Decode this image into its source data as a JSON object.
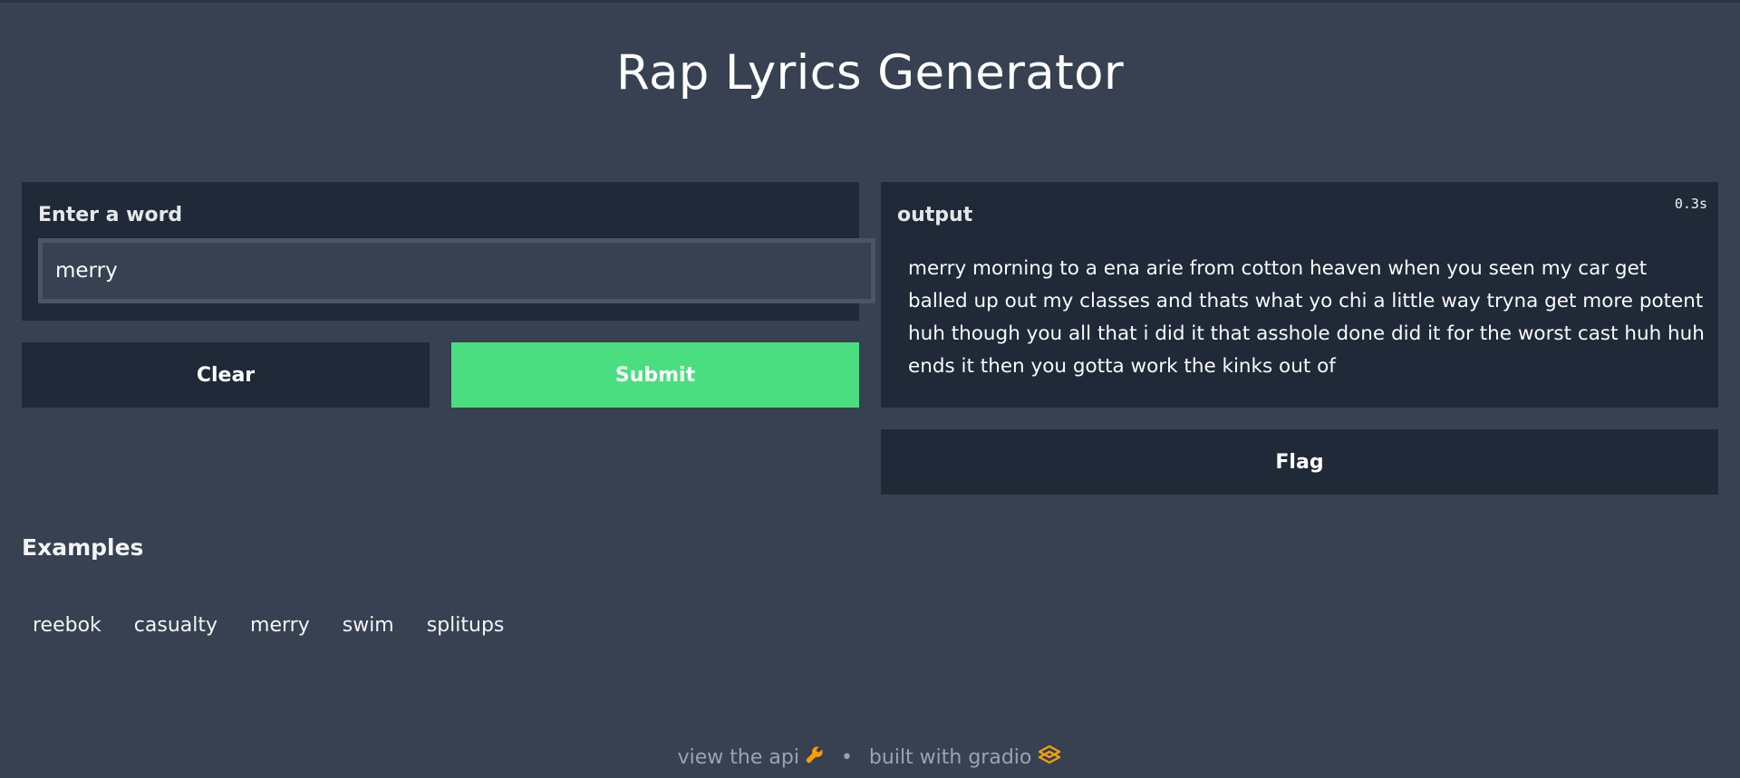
{
  "app": {
    "title": "Rap Lyrics Generator"
  },
  "input": {
    "label": "Enter a word",
    "value": "merry"
  },
  "buttons": {
    "clear": "Clear",
    "submit": "Submit",
    "flag": "Flag"
  },
  "output": {
    "label": "output",
    "timer": "0.3s",
    "text": "merry morning to a ena arie from cotton heaven when you seen my car get balled up out my classes and thats what yo chi a little way tryna get more potent huh though you all that i did it that asshole done did it for the worst cast huh huh ends it then you gotta work the kinks out of"
  },
  "examples": {
    "title": "Examples",
    "items": [
      "reebok",
      "casualty",
      "merry",
      "swim",
      "splitups"
    ]
  },
  "footer": {
    "api_link": "view the api",
    "separator": "•",
    "built_with": "built with gradio"
  },
  "colors": {
    "background": "#374151",
    "panel": "#1f2937",
    "submit": "#4ade80",
    "footer_icon": "#f59e0b"
  },
  "icons": {
    "api": "wrench-icon",
    "gradio": "gradio-logo-icon"
  }
}
